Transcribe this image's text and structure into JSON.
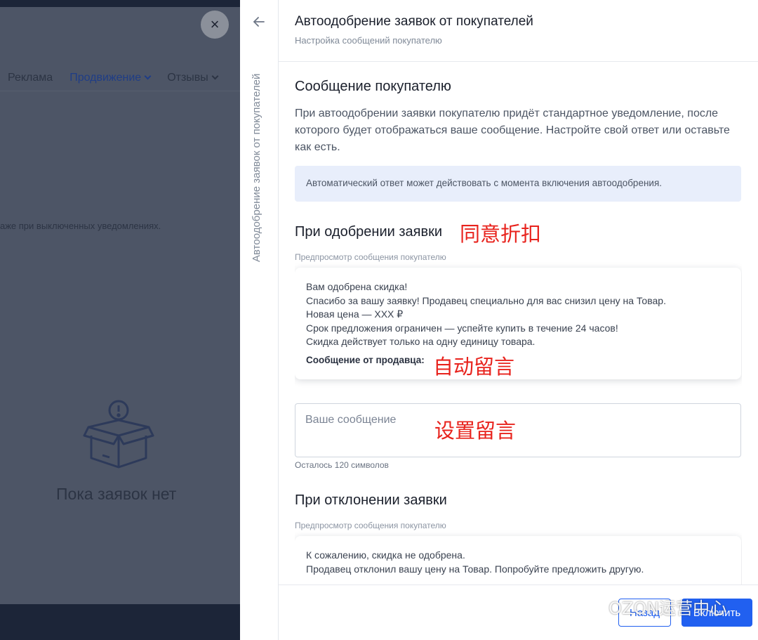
{
  "background": {
    "nav_items": [
      "Реклама",
      "Продвижение",
      "Отзывы"
    ],
    "note": "аже при выключенных уведомлениях.",
    "empty_text": "Пока заявок нет",
    "close_icon": "×"
  },
  "rail": {
    "back_icon": "arrow-left-icon",
    "vertical_title": "Автоодобрение заявок от покупателей"
  },
  "header": {
    "title": "Автоодобрение заявок от покупателей",
    "subtitle": "Настройка сообщений покупателю"
  },
  "section_message": {
    "heading": "Сообщение покупателю",
    "paragraph": "При автоодобрении заявки покупателю придёт стандартное уведомление, после которого будет отображаться ваше сообщение. Настройте свой ответ или оставьте как есть.",
    "info": "Автоматический ответ может действовать с момента включения автоодобрения."
  },
  "approval": {
    "heading": "При одобрении заявки",
    "annotation": "同意折扣",
    "preview_label": "Предпросмотр сообщения покупателю",
    "preview_lines": [
      "Вам одобрена скидка!",
      "Спасибо за вашу заявку! Продавец специально для вас снизил цену на Товар.",
      "Новая цена — XXX ₽",
      "Срок предложения ограничен — успейте купить в течение 24 часов!",
      "Скидка действует только на одну единицу товара."
    ],
    "seller_label": "Сообщение от продавца:",
    "seller_annotation": "自动留言",
    "input_placeholder": "Ваше сообщение",
    "input_annotation": "设置留言",
    "counter": "Осталось 120 символов"
  },
  "rejection": {
    "heading": "При отклонении заявки",
    "preview_label": "Предпросмотр сообщения покупателю",
    "preview_lines": [
      "К сожалению, скидка не одобрена.",
      "Продавец отклонил вашу цену на Товар. Попробуйте предложить другую."
    ]
  },
  "footer": {
    "back_label": "Назад",
    "enable_label": "Включить"
  },
  "watermark": "OZON运营中心",
  "colors": {
    "accent": "#2160f0",
    "annotation_red": "#e8231d",
    "info_bg": "#e8eefb"
  }
}
